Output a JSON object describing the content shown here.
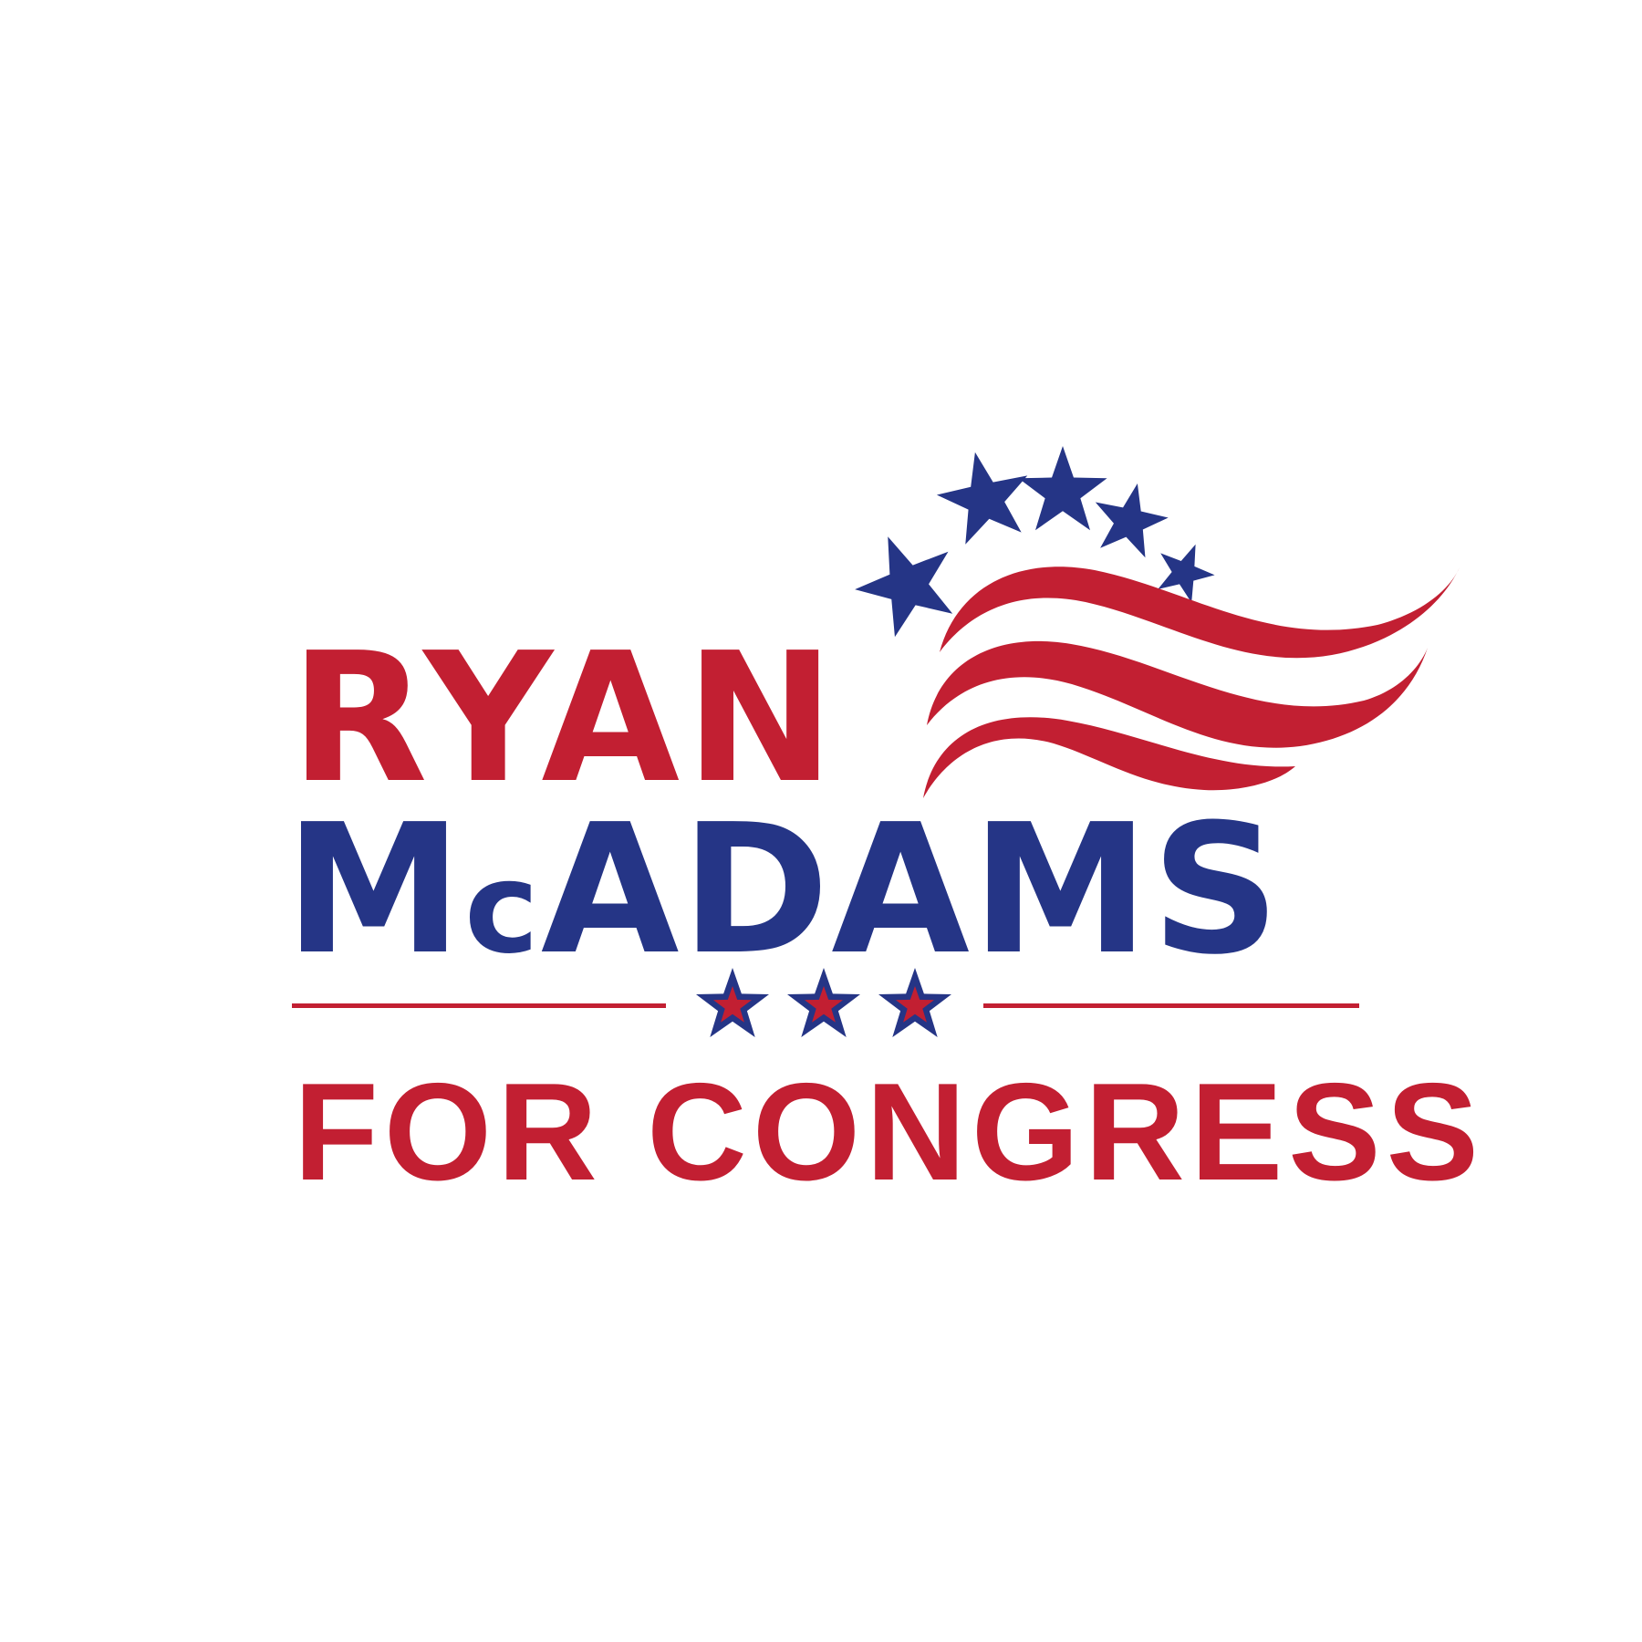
{
  "logo": {
    "first_name": "RYAN",
    "last_name_prefix": "M",
    "last_name_small": "c",
    "last_name_rest": "ADAMS",
    "tagline": "FOR CONGRESS"
  },
  "colors": {
    "red": "#c21f32",
    "blue": "#253586",
    "background": "#ffffff"
  },
  "icons": {
    "arc_stars": "star-icon",
    "divider_stars": "star-icon",
    "flag_swoosh": "flag-stripes-icon"
  }
}
